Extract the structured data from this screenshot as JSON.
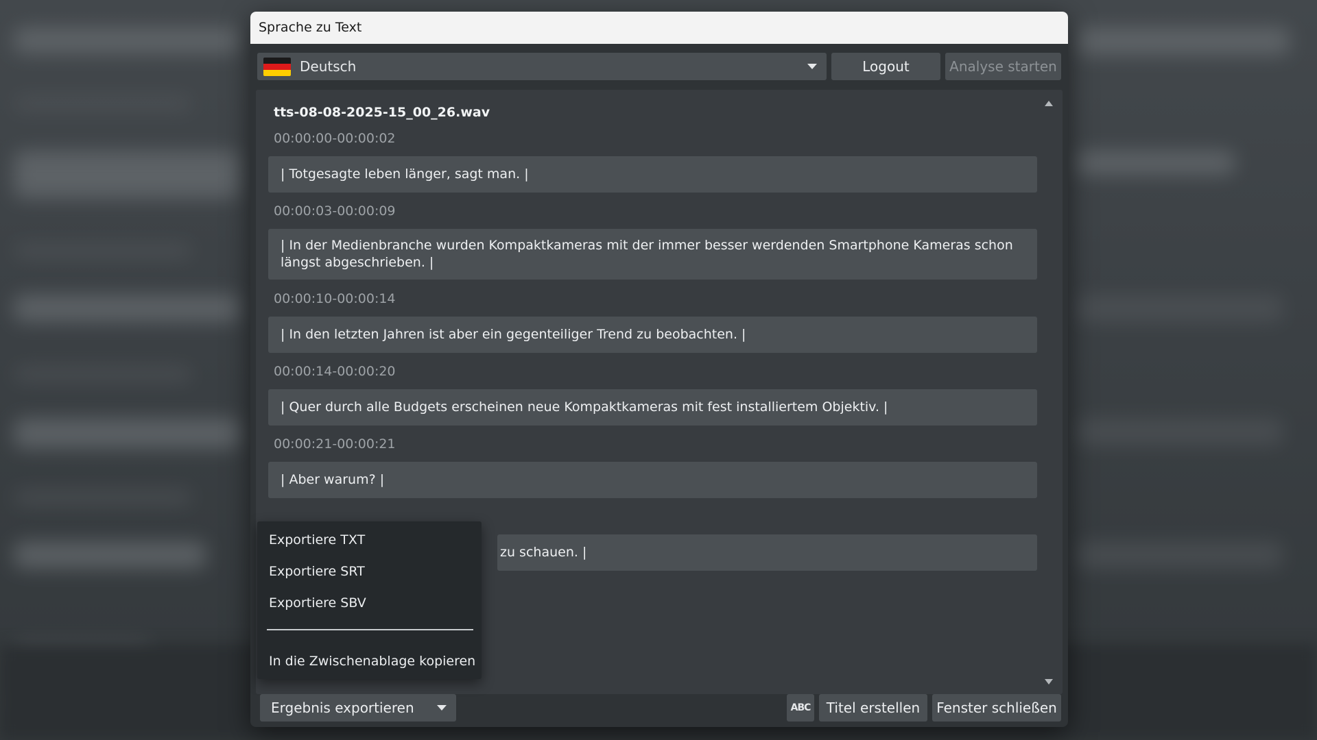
{
  "dialog": {
    "title": "Sprache zu Text"
  },
  "toolbar": {
    "language": "Deutsch",
    "logout_label": "Logout",
    "analyse_label": "Analyse starten"
  },
  "transcript": {
    "filename": "tts-08-08-2025-15_00_26.wav",
    "segments": [
      {
        "time": "00:00:00-00:00:02",
        "text": "| Totgesagte leben länger, sagt man. |"
      },
      {
        "time": "00:00:03-00:00:09",
        "text": "| In der Medienbranche wurden Kompaktkameras mit der immer besser werdenden Smartphone Kameras schon längst abgeschrieben. |"
      },
      {
        "time": "00:00:10-00:00:14",
        "text": "| In den letzten Jahren ist aber ein gegenteiliger Trend zu beobachten. |"
      },
      {
        "time": "00:00:14-00:00:20",
        "text": "| Quer durch alle Budgets erscheinen neue Kompaktkameras mit fest installiertem Objektiv. |"
      },
      {
        "time": "00:00:21-00:00:21",
        "text": "| Aber warum? |"
      },
      {
        "time": "",
        "text": "zu schauen. |"
      }
    ]
  },
  "export_menu": {
    "items": [
      "Exportiere TXT",
      "Exportiere SRT",
      "Exportiere SBV"
    ],
    "copy_label": "In die Zwischenablage kopieren"
  },
  "bottom_bar": {
    "export_label": "Ergebnis exportieren",
    "abc_label": "ABC",
    "create_title_label": "Titel erstellen",
    "close_label": "Fenster schließen"
  }
}
